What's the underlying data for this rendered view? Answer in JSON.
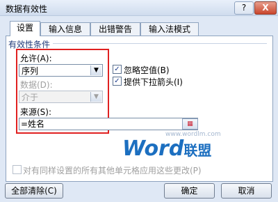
{
  "window": {
    "title": "数据有效性",
    "help": "?",
    "close": "X"
  },
  "tabs": [
    {
      "label": "设置"
    },
    {
      "label": "输入信息"
    },
    {
      "label": "出错警告"
    },
    {
      "label": "输入法模式"
    }
  ],
  "settings": {
    "group_label": "有效性条件",
    "allow_label": "允许(A):",
    "allow_value": "序列",
    "data_label": "数据(D):",
    "data_value": "介于",
    "ignore_blank": {
      "label": "忽略空值(B)",
      "checked": true
    },
    "dropdown": {
      "label": "提供下拉箭头(I)",
      "checked": true
    },
    "source_label": "来源(S):",
    "source_value": "=姓名",
    "apply_label": "对有同样设置的所有其他单元格应用这些更改(P)"
  },
  "watermark": {
    "word": "Word",
    "cn": "联盟",
    "url": "www.wordlm.com"
  },
  "buttons": {
    "clear_all": "全部清除(C)",
    "ok": "确定",
    "cancel": "取消"
  },
  "colors": {
    "highlight": "#e02020",
    "accent": "#1c6fc0"
  }
}
